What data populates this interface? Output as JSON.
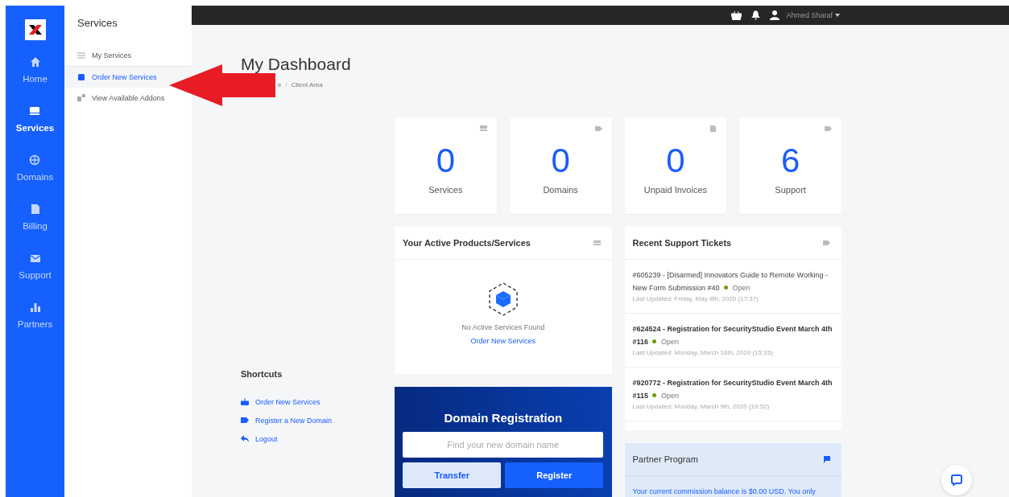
{
  "nav": [
    {
      "label": "Home",
      "selected": false
    },
    {
      "label": "Services",
      "selected": true
    },
    {
      "label": "Domains",
      "selected": false
    },
    {
      "label": "Billing",
      "selected": false
    },
    {
      "label": "Support",
      "selected": false
    },
    {
      "label": "Partners",
      "selected": false
    }
  ],
  "submenu": {
    "title": "Services",
    "items": [
      {
        "label": "My Services",
        "selected": false
      },
      {
        "label": "Order New Services",
        "selected": true
      },
      {
        "label": "View Available Addons",
        "selected": false
      }
    ]
  },
  "topbar": {
    "user": "Ahmed Sharaf"
  },
  "page": {
    "title": "My Dashboard",
    "breadcrumb": [
      "e",
      "Client Area"
    ],
    "separator": "/"
  },
  "shortcuts": {
    "title": "Shortcuts",
    "items": [
      "Order New Services",
      "Register a New Domain",
      "Logout"
    ]
  },
  "tiles": [
    {
      "value": "0",
      "label": "Services"
    },
    {
      "value": "0",
      "label": "Domains"
    },
    {
      "value": "0",
      "label": "Unpaid Invoices"
    },
    {
      "value": "6",
      "label": "Support"
    }
  ],
  "products": {
    "title": "Your Active Products/Services",
    "empty": "No Active Services Found",
    "link": "Order New Services"
  },
  "tickets": {
    "title": "Recent Support Tickets",
    "items": [
      {
        "title": "#605239 - [Disarmed] Innovators Guide to Remote Working - New Form Submission #40",
        "unread": false,
        "status": "Open",
        "updated": "Last Updated: Friday, May 8th, 2020 (17:37)"
      },
      {
        "title": "#624524 - Registration for SecurityStudio Event March 4th #116",
        "unread": true,
        "status": "Open",
        "updated": "Last Updated: Monday, March 16th, 2020 (15:15)"
      },
      {
        "title": "#920772 - Registration for SecurityStudio Event March 4th #115",
        "unread": true,
        "status": "Open",
        "updated": "Last Updated: Monday, March 9th, 2020 (19:52)"
      }
    ]
  },
  "domain": {
    "title": "Domain Registration",
    "placeholder": "Find your new domain name",
    "transfer": "Transfer",
    "register": "Register"
  },
  "partner": {
    "title": "Partner Program",
    "text": "Your current commission balance is $0.00 USD. You only"
  }
}
